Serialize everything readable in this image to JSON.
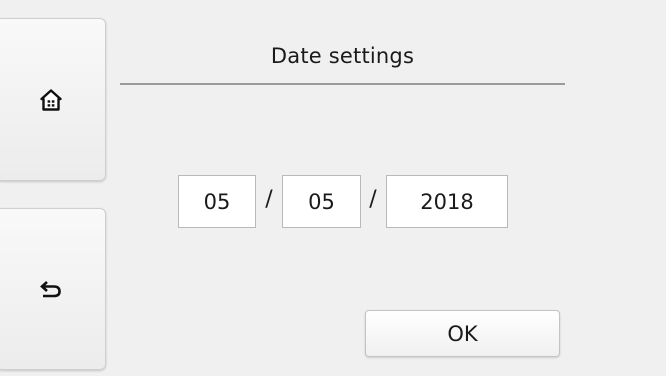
{
  "header": {
    "title": "Date settings"
  },
  "sidebar": {
    "home_icon": "home-icon",
    "back_icon": "back-arrow-icon"
  },
  "date": {
    "month": "05",
    "day": "05",
    "year": "2018",
    "separator": "/"
  },
  "footer": {
    "ok_label": "OK"
  },
  "colors": {
    "background": "#f0f0f0",
    "field_background": "#ffffff",
    "rule": "#9a9a9a"
  }
}
